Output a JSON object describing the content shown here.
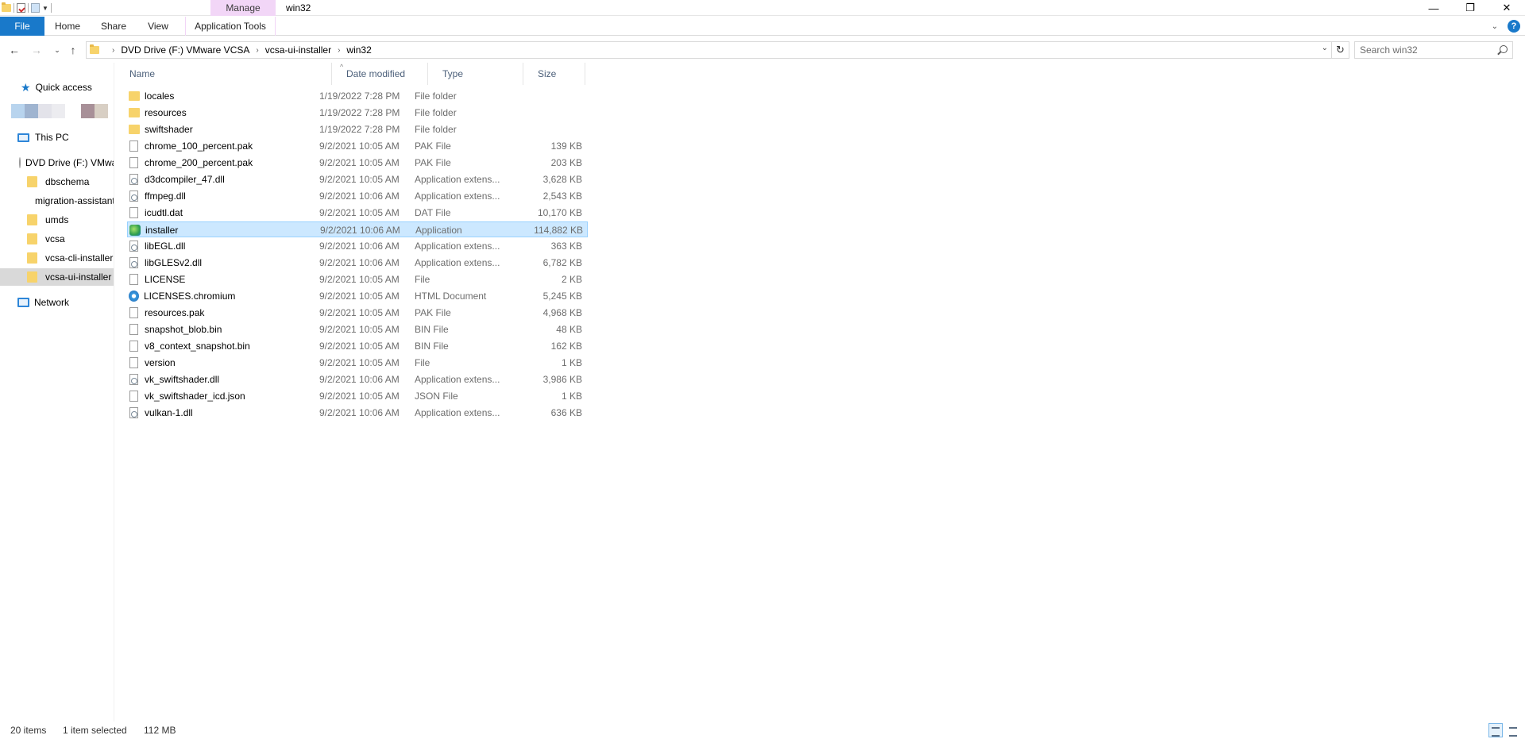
{
  "window": {
    "title": "win32",
    "context_tab": "Manage",
    "controls": {
      "minimize": "—",
      "restore": "❐",
      "close": "✕"
    }
  },
  "ribbon": {
    "tabs": [
      "File",
      "Home",
      "Share",
      "View",
      "Application Tools"
    ],
    "help": "?"
  },
  "address": {
    "crumbs": [
      "DVD Drive (F:) VMware VCSA",
      "vcsa-ui-installer",
      "win32"
    ]
  },
  "search": {
    "placeholder": "Search win32"
  },
  "navpane": {
    "quick_access": "Quick access",
    "this_pc": "This PC",
    "dvd": "DVD Drive (F:) VMware VCSA",
    "folders": [
      "dbschema",
      "migration-assistant",
      "umds",
      "vcsa",
      "vcsa-cli-installer",
      "vcsa-ui-installer"
    ],
    "network": "Network",
    "selected": "vcsa-ui-installer",
    "swatch_colors": [
      "#b8d4ee",
      "#9fb4d0",
      "#e3e3ea",
      "#ececf0",
      "#ffffff",
      "#a89098",
      "#d8cfc4"
    ]
  },
  "columns": {
    "name": "Name",
    "date": "Date modified",
    "type": "Type",
    "size": "Size"
  },
  "files": [
    {
      "name": "locales",
      "date": "1/19/2022 7:28 PM",
      "type": "File folder",
      "size": "",
      "icon": "folder"
    },
    {
      "name": "resources",
      "date": "1/19/2022 7:28 PM",
      "type": "File folder",
      "size": "",
      "icon": "folder"
    },
    {
      "name": "swiftshader",
      "date": "1/19/2022 7:28 PM",
      "type": "File folder",
      "size": "",
      "icon": "folder"
    },
    {
      "name": "chrome_100_percent.pak",
      "date": "9/2/2021 10:05 AM",
      "type": "PAK File",
      "size": "139 KB",
      "icon": "file"
    },
    {
      "name": "chrome_200_percent.pak",
      "date": "9/2/2021 10:05 AM",
      "type": "PAK File",
      "size": "203 KB",
      "icon": "file"
    },
    {
      "name": "d3dcompiler_47.dll",
      "date": "9/2/2021 10:05 AM",
      "type": "Application extens...",
      "size": "3,628 KB",
      "icon": "dll"
    },
    {
      "name": "ffmpeg.dll",
      "date": "9/2/2021 10:06 AM",
      "type": "Application extens...",
      "size": "2,543 KB",
      "icon": "dll"
    },
    {
      "name": "icudtl.dat",
      "date": "9/2/2021 10:05 AM",
      "type": "DAT File",
      "size": "10,170 KB",
      "icon": "file"
    },
    {
      "name": "installer",
      "date": "9/2/2021 10:06 AM",
      "type": "Application",
      "size": "114,882 KB",
      "icon": "app",
      "selected": true
    },
    {
      "name": "libEGL.dll",
      "date": "9/2/2021 10:06 AM",
      "type": "Application extens...",
      "size": "363 KB",
      "icon": "dll"
    },
    {
      "name": "libGLESv2.dll",
      "date": "9/2/2021 10:06 AM",
      "type": "Application extens...",
      "size": "6,782 KB",
      "icon": "dll"
    },
    {
      "name": "LICENSE",
      "date": "9/2/2021 10:05 AM",
      "type": "File",
      "size": "2 KB",
      "icon": "file"
    },
    {
      "name": "LICENSES.chromium",
      "date": "9/2/2021 10:05 AM",
      "type": "HTML Document",
      "size": "5,245 KB",
      "icon": "html"
    },
    {
      "name": "resources.pak",
      "date": "9/2/2021 10:05 AM",
      "type": "PAK File",
      "size": "4,968 KB",
      "icon": "file"
    },
    {
      "name": "snapshot_blob.bin",
      "date": "9/2/2021 10:05 AM",
      "type": "BIN File",
      "size": "48 KB",
      "icon": "file"
    },
    {
      "name": "v8_context_snapshot.bin",
      "date": "9/2/2021 10:05 AM",
      "type": "BIN File",
      "size": "162 KB",
      "icon": "file"
    },
    {
      "name": "version",
      "date": "9/2/2021 10:05 AM",
      "type": "File",
      "size": "1 KB",
      "icon": "file"
    },
    {
      "name": "vk_swiftshader.dll",
      "date": "9/2/2021 10:06 AM",
      "type": "Application extens...",
      "size": "3,986 KB",
      "icon": "dll"
    },
    {
      "name": "vk_swiftshader_icd.json",
      "date": "9/2/2021 10:05 AM",
      "type": "JSON File",
      "size": "1 KB",
      "icon": "file"
    },
    {
      "name": "vulkan-1.dll",
      "date": "9/2/2021 10:06 AM",
      "type": "Application extens...",
      "size": "636 KB",
      "icon": "dll"
    }
  ],
  "status": {
    "count": "20 items",
    "selection": "1 item selected",
    "size": "112 MB"
  },
  "colors": {
    "accent": "#1979ca",
    "selection_bg": "#cce8ff",
    "selection_border": "#99d1ff",
    "manage_tab": "#f2d6f7"
  }
}
